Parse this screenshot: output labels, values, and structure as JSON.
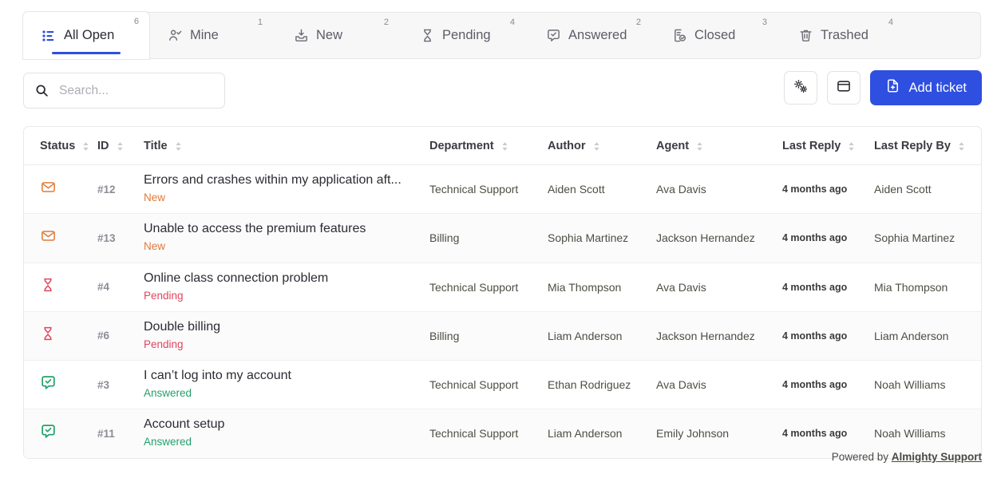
{
  "tabs": [
    {
      "label": "All Open",
      "badge": "6",
      "icon": "list-icon",
      "active": true
    },
    {
      "label": "Mine",
      "badge": "1",
      "icon": "user-check-icon",
      "active": false
    },
    {
      "label": "New",
      "badge": "2",
      "icon": "inbox-download-icon",
      "active": false
    },
    {
      "label": "Pending",
      "badge": "4",
      "icon": "hourglass-icon",
      "active": false
    },
    {
      "label": "Answered",
      "badge": "2",
      "icon": "message-check-icon",
      "active": false
    },
    {
      "label": "Closed",
      "badge": "3",
      "icon": "file-check-icon",
      "active": false
    },
    {
      "label": "Trashed",
      "badge": "4",
      "icon": "trash-icon",
      "active": false
    }
  ],
  "toolbar": {
    "search_placeholder": "Search...",
    "search_value": "",
    "search_icon": "search-icon",
    "settings_icon": "gears-icon",
    "layout_icon": "columns-icon",
    "add_label": "Add ticket",
    "add_icon": "file-plus-icon"
  },
  "table": {
    "columns": [
      {
        "label": "Status",
        "sortable": true
      },
      {
        "label": "ID",
        "sortable": true
      },
      {
        "label": "Title",
        "sortable": true
      },
      {
        "label": "Department",
        "sortable": true
      },
      {
        "label": "Author",
        "sortable": true
      },
      {
        "label": "Agent",
        "sortable": true
      },
      {
        "label": "Last Reply",
        "sortable": true
      },
      {
        "label": "Last Reply By",
        "sortable": true
      }
    ],
    "rows": [
      {
        "status": "New",
        "status_icon": "mail-icon",
        "id": "#12",
        "title": "Errors and crashes within my application aft...",
        "department": "Technical Support",
        "author": "Aiden Scott",
        "agent": "Ava Davis",
        "last_reply": "4 months ago",
        "last_reply_by": "Aiden Scott"
      },
      {
        "status": "New",
        "status_icon": "mail-icon",
        "id": "#13",
        "title": "Unable to access the premium features",
        "department": "Billing",
        "author": "Sophia Martinez",
        "agent": "Jackson Hernandez",
        "last_reply": "4 months ago",
        "last_reply_by": "Sophia Martinez"
      },
      {
        "status": "Pending",
        "status_icon": "hourglass-icon",
        "id": "#4",
        "title": "Online class connection problem",
        "department": "Technical Support",
        "author": "Mia Thompson",
        "agent": "Ava Davis",
        "last_reply": "4 months ago",
        "last_reply_by": "Mia Thompson"
      },
      {
        "status": "Pending",
        "status_icon": "hourglass-icon",
        "id": "#6",
        "title": "Double billing",
        "department": "Billing",
        "author": "Liam Anderson",
        "agent": "Jackson Hernandez",
        "last_reply": "4 months ago",
        "last_reply_by": "Liam Anderson"
      },
      {
        "status": "Answered",
        "status_icon": "message-check-icon",
        "id": "#3",
        "title": "I can’t log into my account",
        "department": "Technical Support",
        "author": "Ethan Rodriguez",
        "agent": "Ava Davis",
        "last_reply": "4 months ago",
        "last_reply_by": "Noah Williams"
      },
      {
        "status": "Answered",
        "status_icon": "message-check-icon",
        "id": "#11",
        "title": "Account setup",
        "department": "Technical Support",
        "author": "Liam Anderson",
        "agent": "Emily Johnson",
        "last_reply": "4 months ago",
        "last_reply_by": "Noah Williams"
      }
    ]
  },
  "footer": {
    "text": "Powered by",
    "link_label": "Almighty Support"
  },
  "colors": {
    "accent": "#2f4fe0",
    "new": "#e07b39",
    "pending": "#e0455e",
    "answered": "#23a06a",
    "muted": "#8c8c96"
  }
}
